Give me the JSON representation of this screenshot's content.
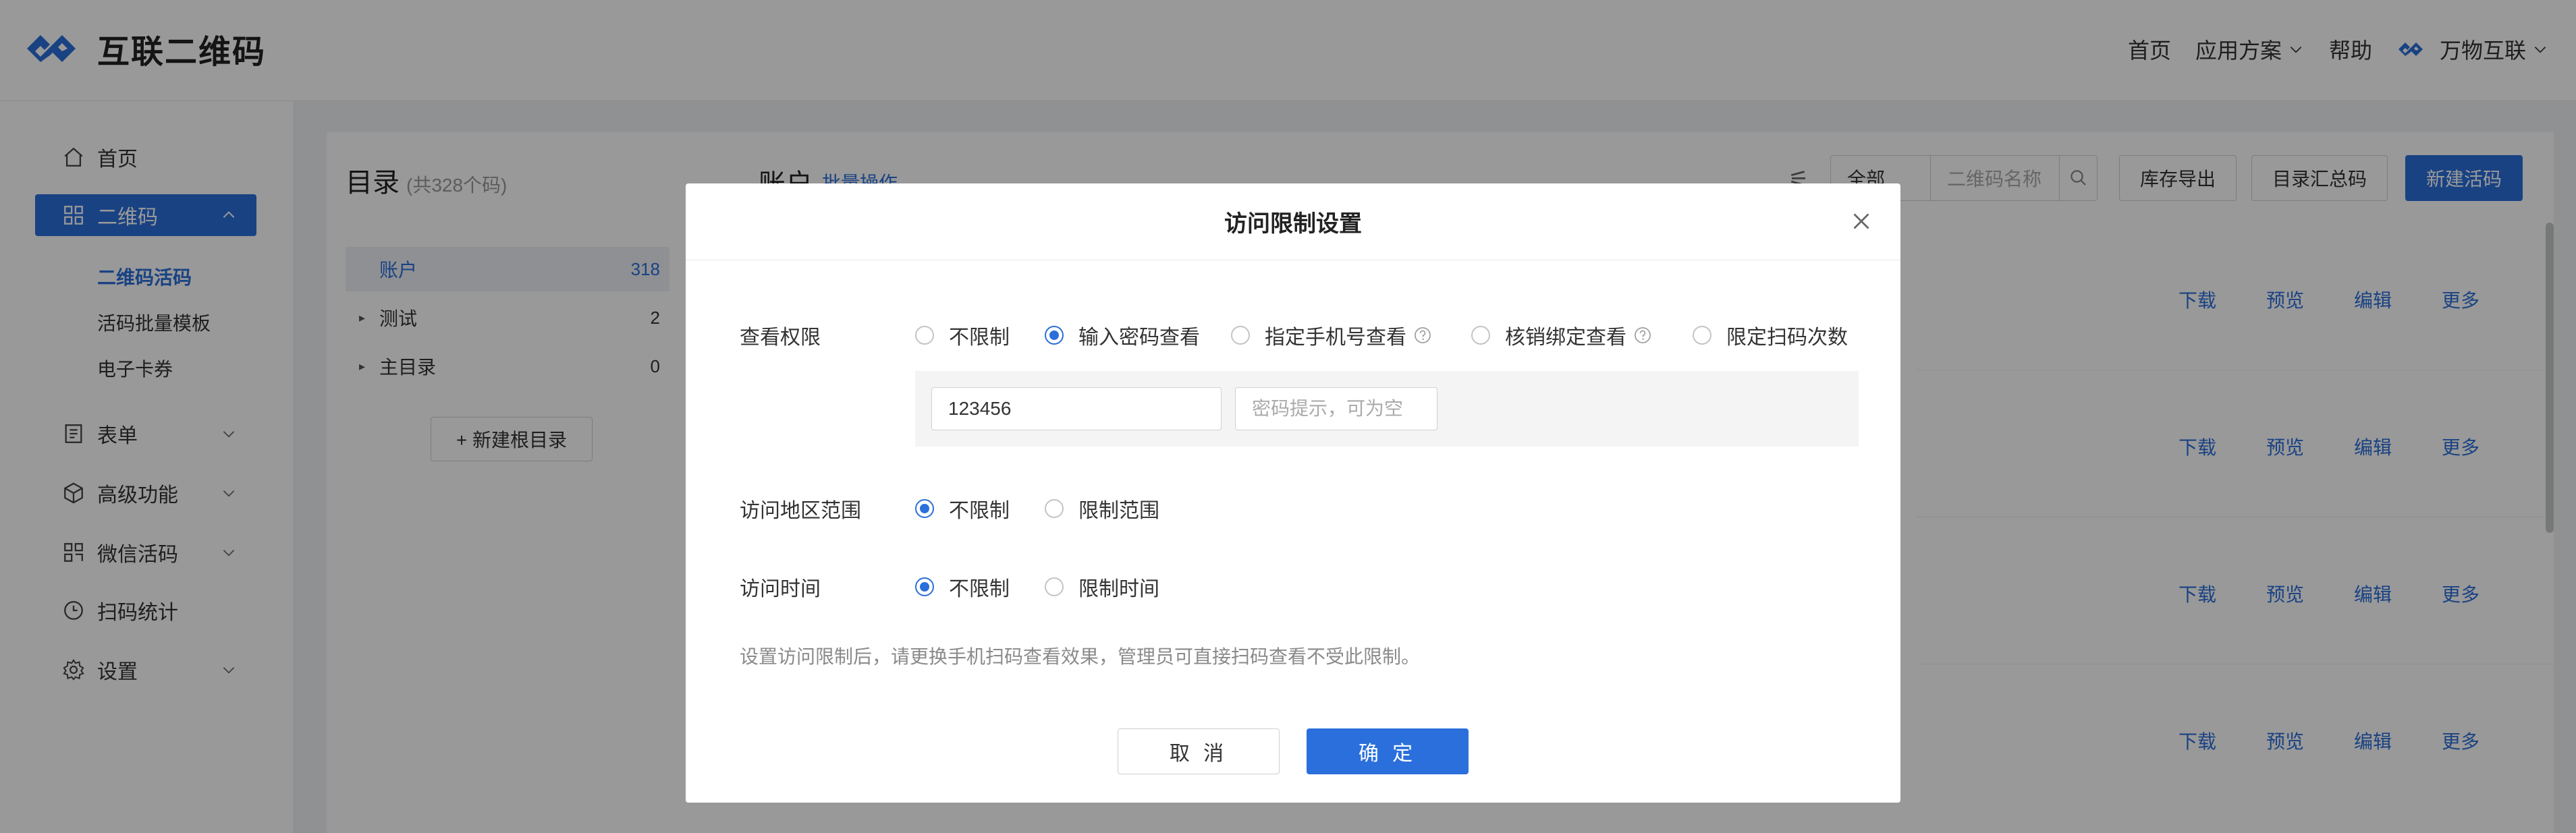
{
  "header": {
    "logo_text": "互联二维码",
    "nav": [
      "首页",
      "应用方案",
      "帮助"
    ],
    "user": "万物互联"
  },
  "sidebar": {
    "items": [
      {
        "label": "首页"
      },
      {
        "label": "二维码"
      },
      {
        "label": "表单"
      },
      {
        "label": "高级功能"
      },
      {
        "label": "微信活码"
      },
      {
        "label": "扫码统计"
      },
      {
        "label": "设置"
      }
    ],
    "sub_items": [
      "二维码活码",
      "活码批量模板",
      "电子卡券"
    ]
  },
  "catalog": {
    "title": "目录",
    "count": "(共328个码)",
    "rows": [
      {
        "label": "账户",
        "count": "318"
      },
      {
        "label": "测试",
        "count": "2"
      },
      {
        "label": "主目录",
        "count": "0"
      }
    ],
    "new_root": "+ 新建根目录"
  },
  "main": {
    "title": "账户",
    "batch": "批量操作",
    "filter_all": "全部",
    "search_placeholder": "二维码名称",
    "buttons": {
      "export": "库存导出",
      "summary": "目录汇总码",
      "create": "新建活码"
    },
    "row_actions": [
      "下载",
      "预览",
      "编辑",
      "更多"
    ]
  },
  "modal": {
    "title": "访问限制设置",
    "view_label": "查看权限",
    "view_options": [
      "不限制",
      "输入密码查看",
      "指定手机号查看",
      "核销绑定查看",
      "限定扫码次数"
    ],
    "view_selected": "输入密码查看",
    "password_value": "123456",
    "password_hint_placeholder": "密码提示，可为空",
    "region_label": "访问地区范围",
    "region_options": [
      "不限制",
      "限制范围"
    ],
    "time_label": "访问时间",
    "time_options": [
      "不限制",
      "限制时间"
    ],
    "hint": "设置访问限制后，请更换手机扫码查看效果，管理员可直接扫码查看不受此限制。",
    "cancel": "取 消",
    "confirm": "确 定"
  },
  "colors": {
    "accent": "#2a6fdb"
  }
}
